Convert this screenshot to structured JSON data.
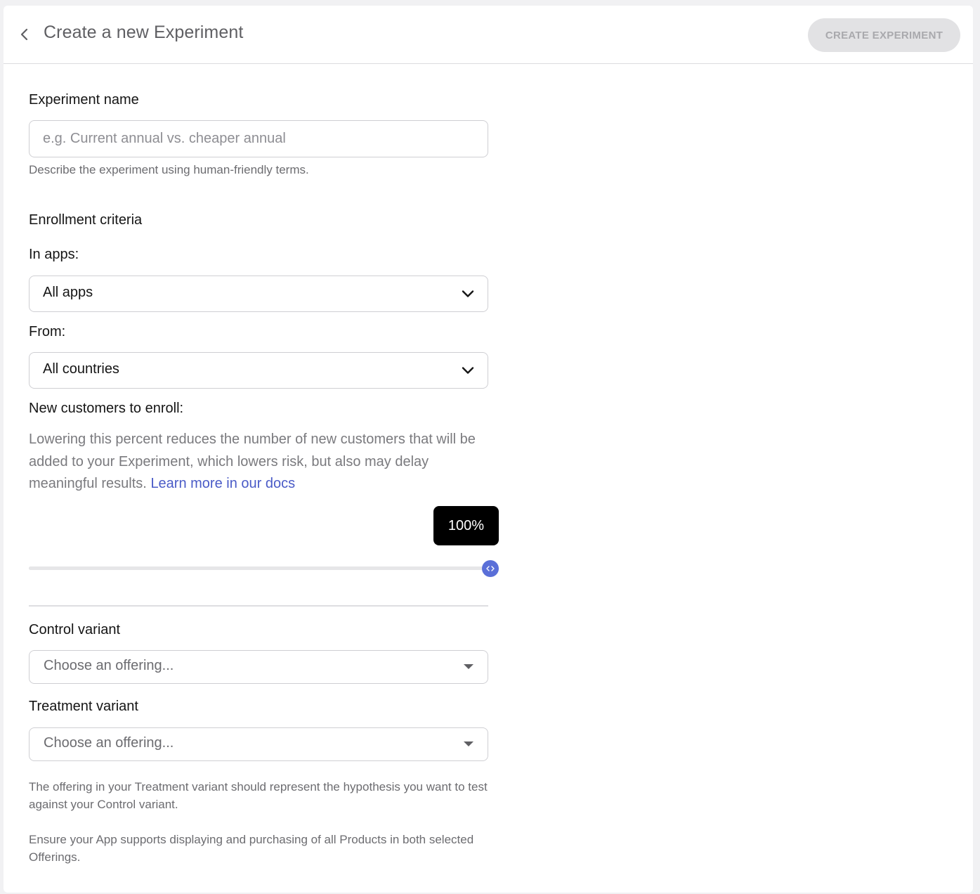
{
  "header": {
    "title": "Create a new Experiment",
    "create_button": "CREATE EXPERIMENT",
    "back_icon": "chevron-left-icon"
  },
  "experiment_name": {
    "label": "Experiment name",
    "placeholder": "e.g. Current annual vs. cheaper annual",
    "value": "",
    "helper": "Describe the experiment using human-friendly terms."
  },
  "enrollment": {
    "section_label": "Enrollment criteria",
    "apps": {
      "label": "In apps:",
      "selected": "All apps"
    },
    "countries": {
      "label": "From:",
      "selected": "All countries"
    },
    "customers": {
      "label": "New customers to enroll:",
      "description": "Lowering this percent reduces the number of new customers that will be added to your Experiment, which lowers risk, but also may delay meaningful results.",
      "link_text": "Learn more in our docs",
      "percent": 100,
      "percent_label": "100%"
    }
  },
  "control_variant": {
    "label": "Control variant",
    "placeholder": "Choose an offering..."
  },
  "treatment_variant": {
    "label": "Treatment variant",
    "placeholder": "Choose an offering..."
  },
  "notes": {
    "treatment_hint": "The offering in your Treatment variant should represent the hypothesis you want to test against your Control variant.",
    "support_hint": "Ensure your App supports displaying and purchasing of all Products in both selected Offerings."
  },
  "colors": {
    "accent": "#5a6fd8",
    "link": "#4a5bc7",
    "button_disabled_bg": "#e2e2e4",
    "button_disabled_text": "#a9a9ad"
  }
}
